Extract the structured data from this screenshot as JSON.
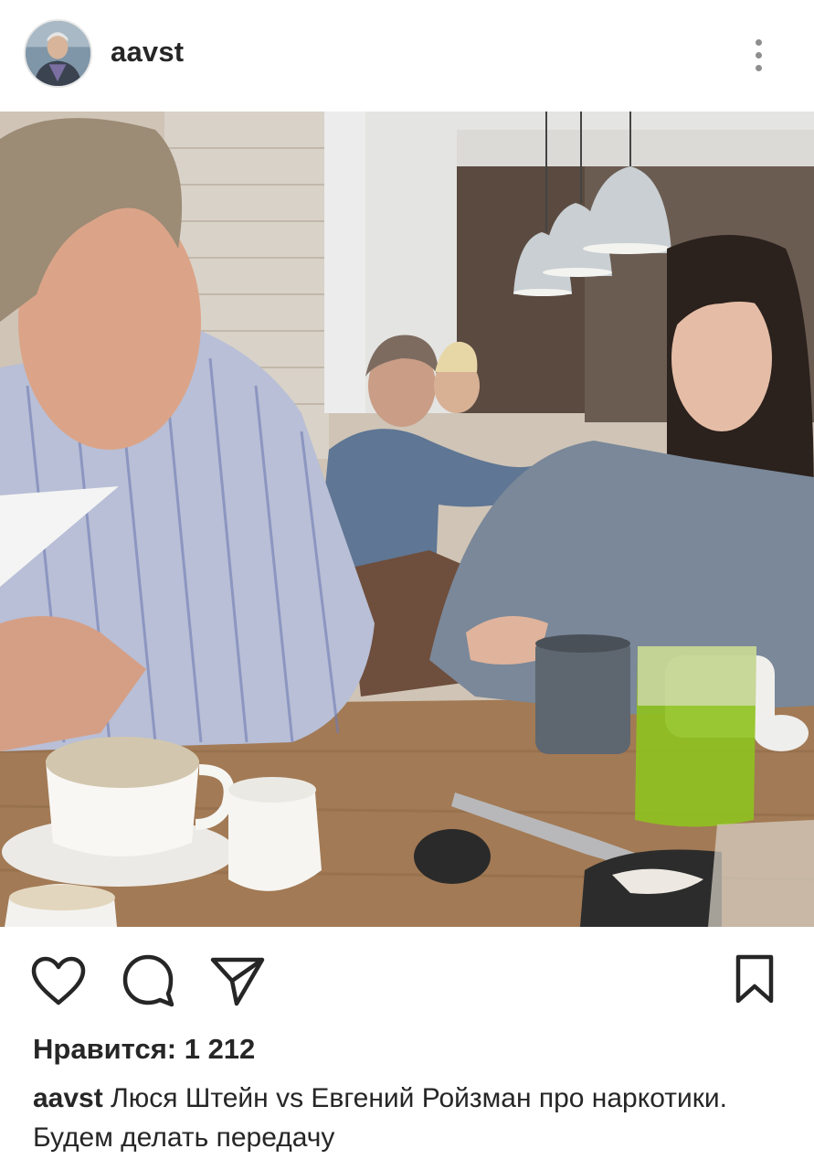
{
  "post": {
    "username": "aavst",
    "likes_text": "Нравится: 1 212",
    "caption": {
      "username": "aavst",
      "text": "Люся Штейн vs Евгений Ройзман про наркотики. Будем делать передачу"
    }
  },
  "icons": {
    "avatar": "user-avatar",
    "more": "more-vertical-icon",
    "like": "heart-icon",
    "comment": "comment-bubble-icon",
    "share": "paper-plane-icon",
    "save": "bookmark-icon"
  },
  "colors": {
    "text": "#262626",
    "secondary": "#8e8e8e",
    "background": "#ffffff"
  }
}
